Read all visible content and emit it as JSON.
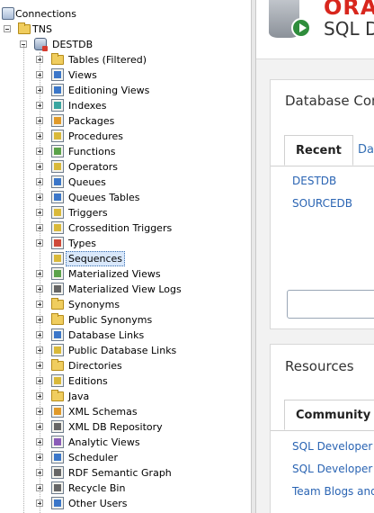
{
  "tree": {
    "root": "Connections",
    "tns": "TNS",
    "db": "DESTDB",
    "items": [
      "Tables (Filtered)",
      "Views",
      "Editioning Views",
      "Indexes",
      "Packages",
      "Procedures",
      "Functions",
      "Operators",
      "Queues",
      "Queues Tables",
      "Triggers",
      "Crossedition Triggers",
      "Types",
      "Sequences",
      "Materialized Views",
      "Materialized View Logs",
      "Synonyms",
      "Public Synonyms",
      "Database Links",
      "Public Database Links",
      "Directories",
      "Editions",
      "Java",
      "XML Schemas",
      "XML DB Repository",
      "Analytic Views",
      "Scheduler",
      "RDF Semantic Graph",
      "Recycle Bin",
      "Other Users"
    ],
    "selected": "Sequences"
  },
  "start_page": {
    "brand": "ORACLE",
    "product": "SQL Developer",
    "db_panel": {
      "title": "Database Connections",
      "tab_recent": "Recent",
      "tab_other": "Databases",
      "connections": [
        "DESTDB",
        "SOURCEDB"
      ]
    },
    "resources_panel": {
      "title": "Resources",
      "tab_community": "Community",
      "links": [
        "SQL Developer Exchange",
        "SQL Developer Forum",
        "Team Blogs and"
      ]
    }
  },
  "colors": {
    "brand_red": "#d8261d",
    "link_blue": "#2a64b3",
    "selection": "#d9e8fb"
  }
}
